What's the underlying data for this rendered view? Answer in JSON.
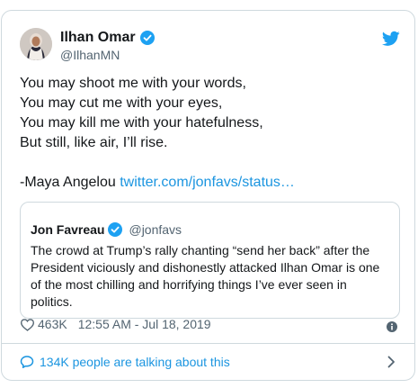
{
  "tweet": {
    "author_name": "Ilhan Omar",
    "author_handle": "@IlhanMN",
    "text_lines": [
      "You may shoot me with your words,",
      "You may cut me with your eyes,",
      "You may kill me with your hatefulness,",
      "But still, like air, I’ll rise."
    ],
    "attribution": "-Maya Angelou",
    "link_text": "twitter.com/jonfavs/status…",
    "likes": "463K",
    "timestamp": "12:55 AM - Jul 18, 2019"
  },
  "quoted_tweet": {
    "author_name": "Jon Favreau",
    "author_handle": "@jonfavs",
    "text_lines": [
      "The crowd at Trump’s rally chanting “send her back” after the",
      "President viciously and dishonestly attacked Ilhan Omar is one",
      "of the most chilling and horrifying things I’ve ever seen in",
      "politics."
    ]
  },
  "footer": {
    "talking_text": "134K people are talking about this"
  },
  "colors": {
    "accent": "#1b95e0",
    "verified": "#1da1f2",
    "text": "#14171a",
    "secondary": "#536471",
    "border": "#cfd9de"
  },
  "icons": [
    "avatar",
    "verified-badge-icon",
    "twitter-bird-icon",
    "heart-icon",
    "info-icon",
    "speech-bubble-icon",
    "chevron-right-icon"
  ]
}
